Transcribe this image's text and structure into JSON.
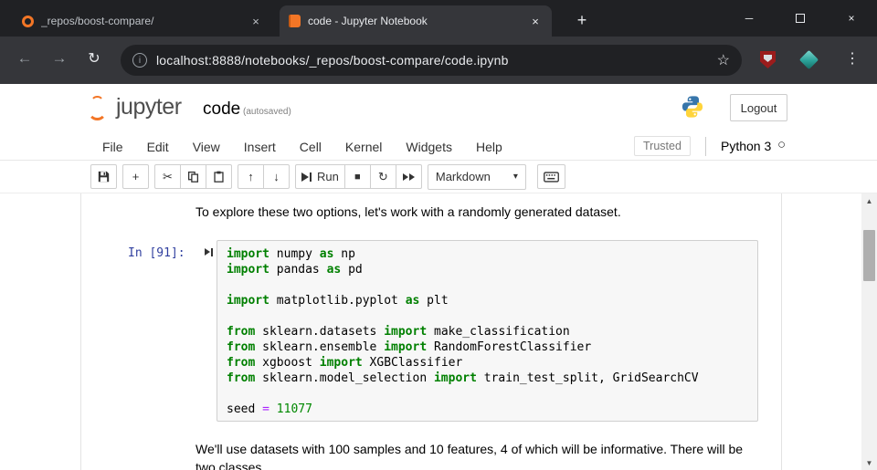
{
  "window": {
    "tabs": [
      {
        "title": "_repos/boost-compare/"
      },
      {
        "title": "code - Jupyter Notebook"
      }
    ]
  },
  "nav": {
    "url": "localhost:8888/notebooks/_repos/boost-compare/code.ipynb"
  },
  "header": {
    "logo": "jupyter",
    "title": "code",
    "status": "(autosaved)",
    "logout": "Logout"
  },
  "menubar": {
    "items": [
      "File",
      "Edit",
      "View",
      "Insert",
      "Cell",
      "Kernel",
      "Widgets",
      "Help"
    ],
    "trusted": "Trusted",
    "kernel_name": "Python 3"
  },
  "toolbar": {
    "run": "Run",
    "cell_type": "Markdown"
  },
  "notebook": {
    "md_above": "To explore these two options, let's work with a randomly generated dataset.",
    "prompt": "In [91]:",
    "code": {
      "lines": [
        [
          {
            "c": "kw",
            "t": "import"
          },
          {
            "c": "pl",
            "t": " numpy "
          },
          {
            "c": "kw",
            "t": "as"
          },
          {
            "c": "pl",
            "t": " np"
          }
        ],
        [
          {
            "c": "kw",
            "t": "import"
          },
          {
            "c": "pl",
            "t": " pandas "
          },
          {
            "c": "kw",
            "t": "as"
          },
          {
            "c": "pl",
            "t": " pd"
          }
        ],
        [],
        [
          {
            "c": "kw",
            "t": "import"
          },
          {
            "c": "pl",
            "t": " matplotlib.pyplot "
          },
          {
            "c": "kw",
            "t": "as"
          },
          {
            "c": "pl",
            "t": " plt"
          }
        ],
        [],
        [
          {
            "c": "kw",
            "t": "from"
          },
          {
            "c": "pl",
            "t": " sklearn.datasets "
          },
          {
            "c": "kw",
            "t": "import"
          },
          {
            "c": "pl",
            "t": " make_classification"
          }
        ],
        [
          {
            "c": "kw",
            "t": "from"
          },
          {
            "c": "pl",
            "t": " sklearn.ensemble "
          },
          {
            "c": "kw",
            "t": "import"
          },
          {
            "c": "pl",
            "t": " RandomForestClassifier"
          }
        ],
        [
          {
            "c": "kw",
            "t": "from"
          },
          {
            "c": "pl",
            "t": " xgboost "
          },
          {
            "c": "kw",
            "t": "import"
          },
          {
            "c": "pl",
            "t": " XGBClassifier"
          }
        ],
        [
          {
            "c": "kw",
            "t": "from"
          },
          {
            "c": "pl",
            "t": " sklearn.model_selection "
          },
          {
            "c": "kw",
            "t": "import"
          },
          {
            "c": "pl",
            "t": " train_test_split, GridSearchCV"
          }
        ],
        [],
        [
          {
            "c": "pl",
            "t": "seed "
          },
          {
            "c": "op",
            "t": "="
          },
          {
            "c": "pl",
            "t": " "
          },
          {
            "c": "num",
            "t": "11077"
          }
        ]
      ]
    },
    "md_below": [
      "We'll use datasets with 100 samples and 10 features, 4 of which will be informative. There will be",
      "two classes"
    ]
  },
  "icons": {
    "close": "×",
    "new_tab": "+",
    "minimize": "─",
    "back": "←",
    "forward": "→",
    "reload": "↻",
    "info_letter": "i",
    "star": "☆",
    "kebab": "⋮",
    "plus": "+",
    "cut": "✂",
    "up": "↑",
    "down": "↓",
    "stop": "■",
    "restart": "↻",
    "caret": "▾",
    "kernel_idle": "○",
    "scroll_up": "▲",
    "scroll_down": "▼"
  },
  "colors": {
    "jupyter_orange": "#F37626",
    "prompt_blue": "#303F9F",
    "keyword_green": "#008000",
    "number_green": "#008800",
    "operator_purple": "#AA22FF",
    "chrome_dark": "#202124",
    "chrome_toolbar": "#35363A"
  }
}
